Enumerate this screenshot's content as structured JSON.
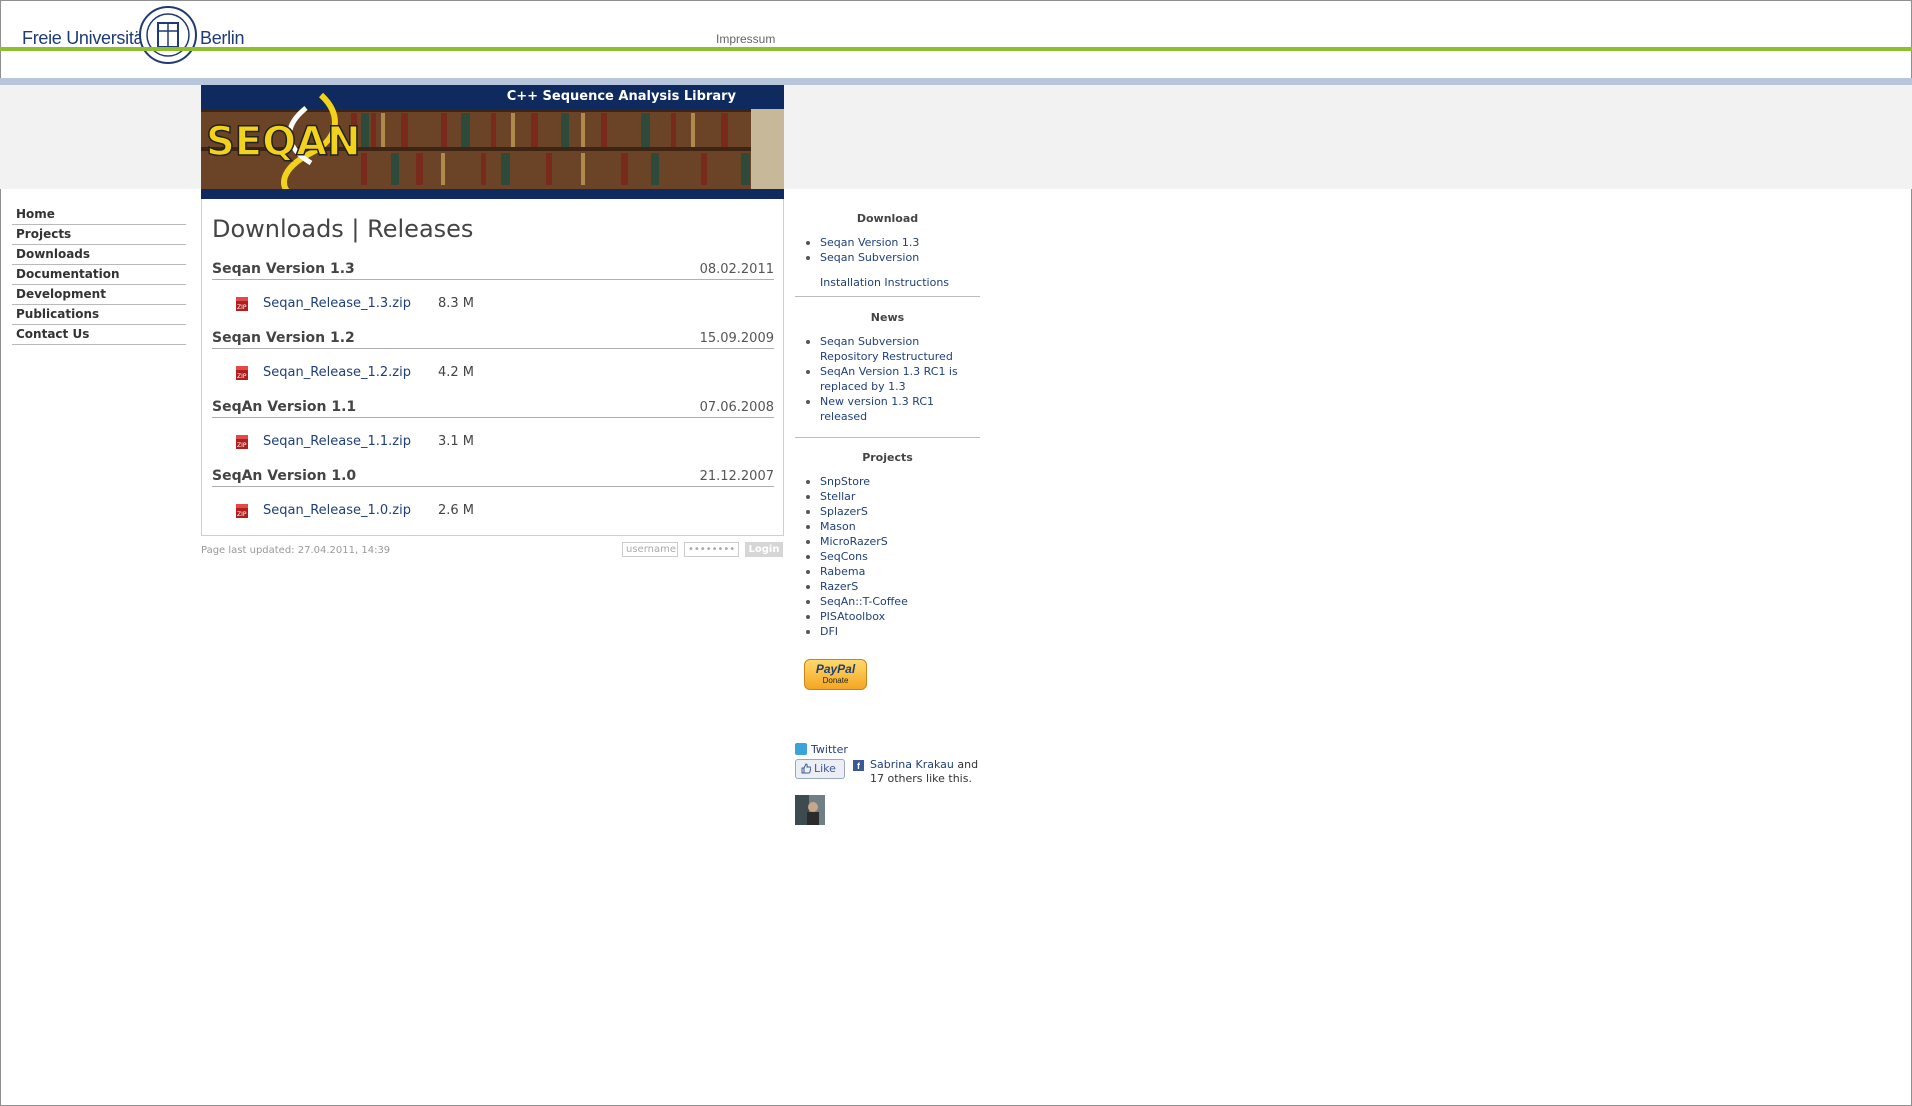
{
  "header": {
    "university_left": "Freie Universität",
    "university_right": "Berlin",
    "impressum": "Impressum"
  },
  "banner": {
    "tagline": "C++ Sequence Analysis Library",
    "logo_text": "SEQAN"
  },
  "nav": {
    "items": [
      {
        "label": "Home"
      },
      {
        "label": "Projects"
      },
      {
        "label": "Downloads"
      },
      {
        "label": "Documentation"
      },
      {
        "label": "Development"
      },
      {
        "label": "Publications"
      },
      {
        "label": "Contact Us"
      }
    ]
  },
  "content": {
    "title": "Downloads | Releases",
    "releases": [
      {
        "name": "Seqan Version 1.3",
        "date": "08.02.2011",
        "file": "Seqan_Release_1.3.zip",
        "size": "8.3 M"
      },
      {
        "name": "Seqan Version 1.2",
        "date": "15.09.2009",
        "file": "Seqan_Release_1.2.zip",
        "size": "4.2 M"
      },
      {
        "name": "SeqAn Version 1.1",
        "date": "07.06.2008",
        "file": "Seqan_Release_1.1.zip",
        "size": "3.1 M"
      },
      {
        "name": "SeqAn Version 1.0",
        "date": "21.12.2007",
        "file": "Seqan_Release_1.0.zip",
        "size": "2.6 M"
      }
    ]
  },
  "footer": {
    "last_updated": "Page last updated:  27.04.2011, 14:39",
    "username_placeholder": "username",
    "password_placeholder": "••••••••",
    "login_label": "Login"
  },
  "sidebar": {
    "download": {
      "title": "Download",
      "items": [
        "Seqan Version 1.3",
        "Seqan Subversion"
      ],
      "install": "Installation Instructions"
    },
    "news": {
      "title": "News",
      "items": [
        "Seqan Subversion Repository Restructured",
        "SeqAn Version 1.3 RC1 is replaced by 1.3",
        "New version 1.3 RC1 released"
      ]
    },
    "projects": {
      "title": "Projects",
      "items": [
        "SnpStore",
        "Stellar",
        "SplazerS",
        "Mason",
        "MicroRazerS",
        "SeqCons",
        "Rabema",
        "RazerS",
        "SeqAn::T-Coffee",
        "PISAtoolbox",
        "DFI"
      ]
    },
    "paypal": {
      "label": "PayPal",
      "donate": "Donate"
    },
    "twitter": "Twitter",
    "facebook": {
      "like_button": "Like",
      "like_name": "Sabrina Krakau",
      "like_rest_1": " and",
      "like_rest_2": "17 others like this."
    }
  }
}
